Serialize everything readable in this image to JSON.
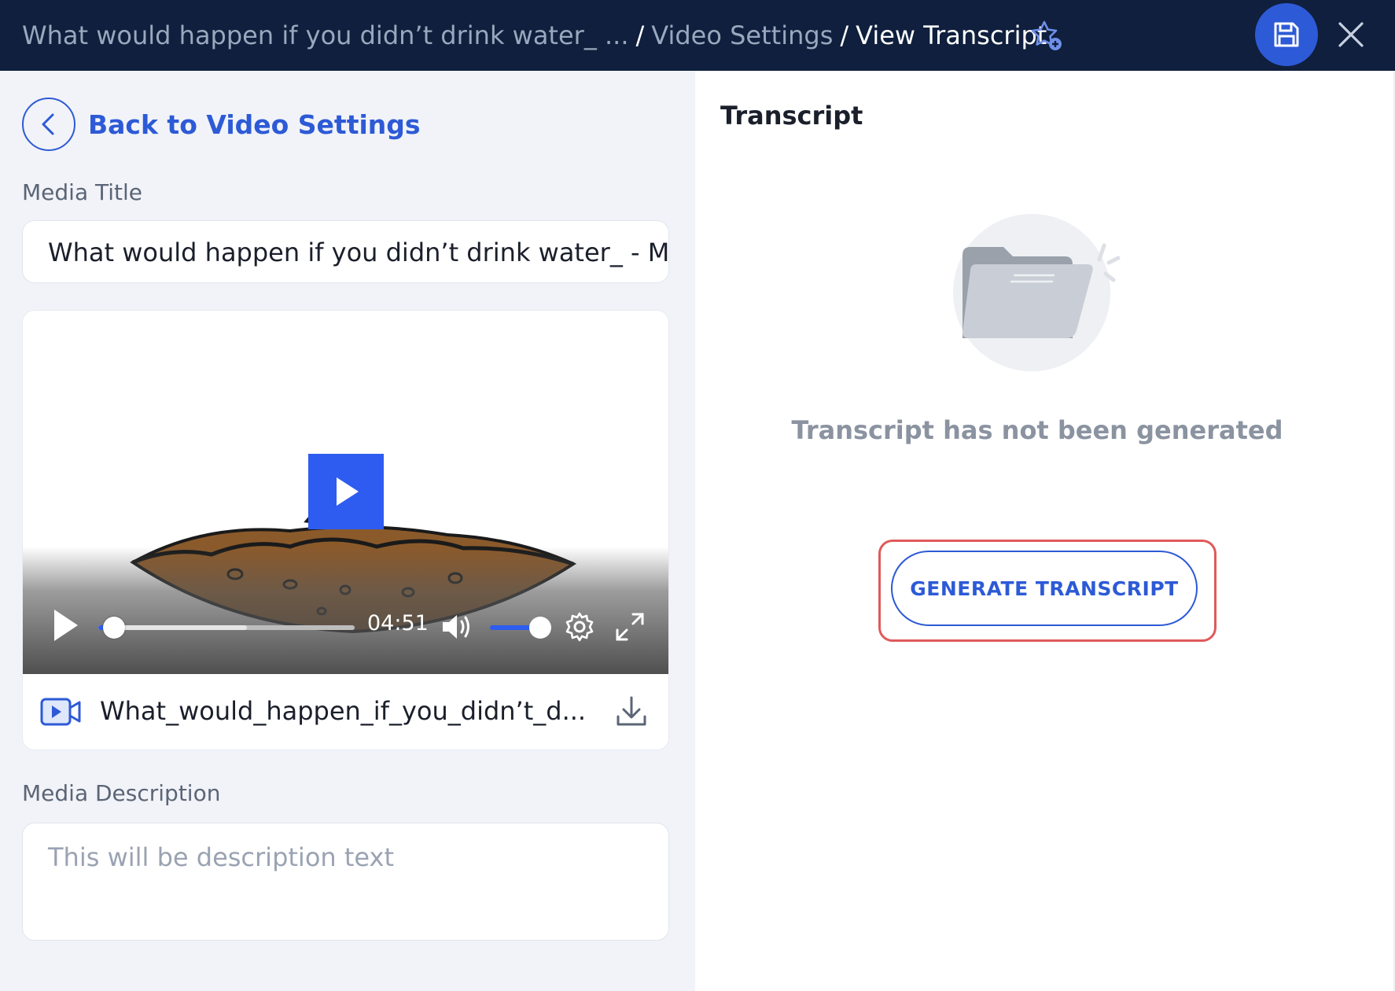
{
  "header": {
    "breadcrumb_1": "What would happen if you didn’t drink water_ ...",
    "sep_1": "/",
    "breadcrumb_2": "Video Settings",
    "sep_2": "/",
    "breadcrumb_current": "View Transcript",
    "icons": [
      "star-add-icon",
      "save-icon",
      "close-icon"
    ]
  },
  "left": {
    "back_label": "Back to Video Settings",
    "media_title_label": "Media Title",
    "media_title_value": "What would happen if you didn’t drink water_ - M",
    "player": {
      "current_time": "04:51",
      "progress": 0.06,
      "buffered": 0.58,
      "volume": 1.0,
      "accent_color": "#2e5cf0"
    },
    "file_name": "What_would_happen_if_you_didn’t_d...",
    "media_description_label": "Media Description",
    "media_description_placeholder": "This will be description text"
  },
  "right": {
    "heading": "Transcript",
    "empty_message": "Transcript has not been generated",
    "generate_button": "GENERATE TRANSCRIPT"
  },
  "colors": {
    "header_bg": "#0f1f3d",
    "primary": "#2d5ad6",
    "highlight": "#e05a5a"
  }
}
